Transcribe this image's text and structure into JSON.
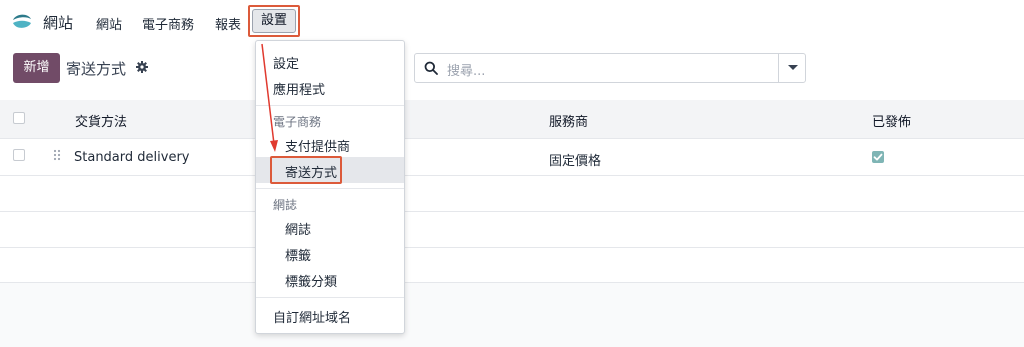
{
  "app": {
    "name": "網站"
  },
  "nav": {
    "items": [
      "網站",
      "電子商務",
      "報表"
    ],
    "active": "設置"
  },
  "control_panel": {
    "new_button": "新增",
    "title": "寄送方式",
    "search_placeholder": "搜尋..."
  },
  "table": {
    "columns": [
      "交貨方法",
      "服務商",
      "已發佈"
    ],
    "rows": [
      {
        "method": "Standard delivery",
        "provider": "固定價格",
        "published": true
      }
    ]
  },
  "dropdown": {
    "settings": "設定",
    "apps": "應用程式",
    "ecommerce_header": "電子商務",
    "payment_providers": "支付提供商",
    "shipping_methods": "寄送方式",
    "blog_header": "網誌",
    "blogs": "網誌",
    "tags": "標籤",
    "tag_categories": "標籤分類",
    "custom_domain": "自訂網址域名"
  },
  "colors": {
    "primary": "#714b67",
    "highlight": "#dc5a3a",
    "arrow": "#e03a2f",
    "checkbox_checked": "#7fb5b5"
  }
}
